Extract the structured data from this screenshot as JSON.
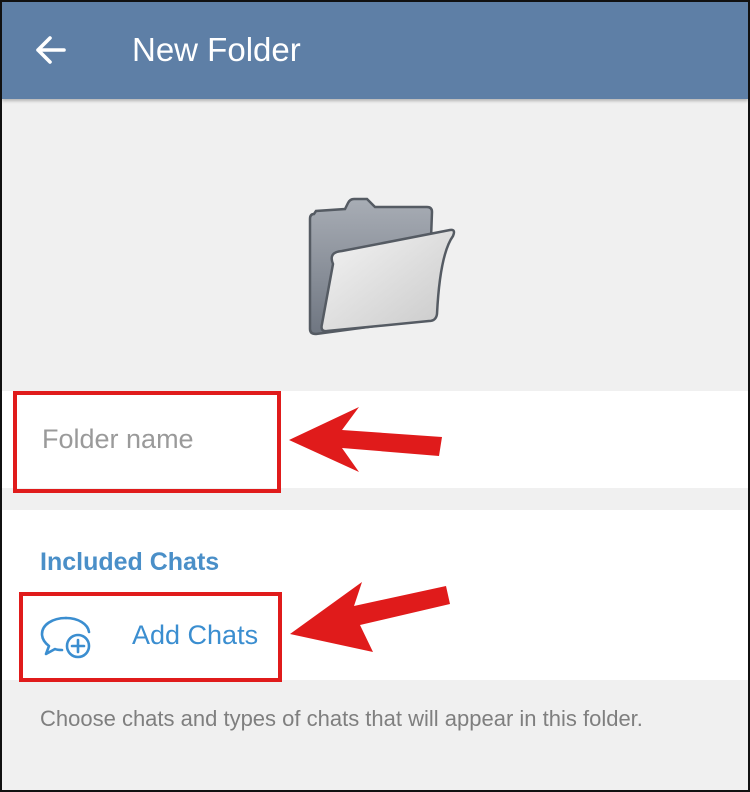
{
  "header": {
    "back_icon": "arrow-left-icon",
    "title": "New Folder"
  },
  "folder_icon": "folder-open-icon",
  "name_field": {
    "placeholder": "Folder name",
    "value": ""
  },
  "included": {
    "header": "Included Chats",
    "add_icon": "chat-add-icon",
    "add_label": "Add Chats"
  },
  "hint": "Choose chats and types of chats that will appear in this folder.",
  "colors": {
    "header_bg": "#5e7fa6",
    "accent": "#3b8ed0",
    "annotation": "#e01b1b"
  }
}
